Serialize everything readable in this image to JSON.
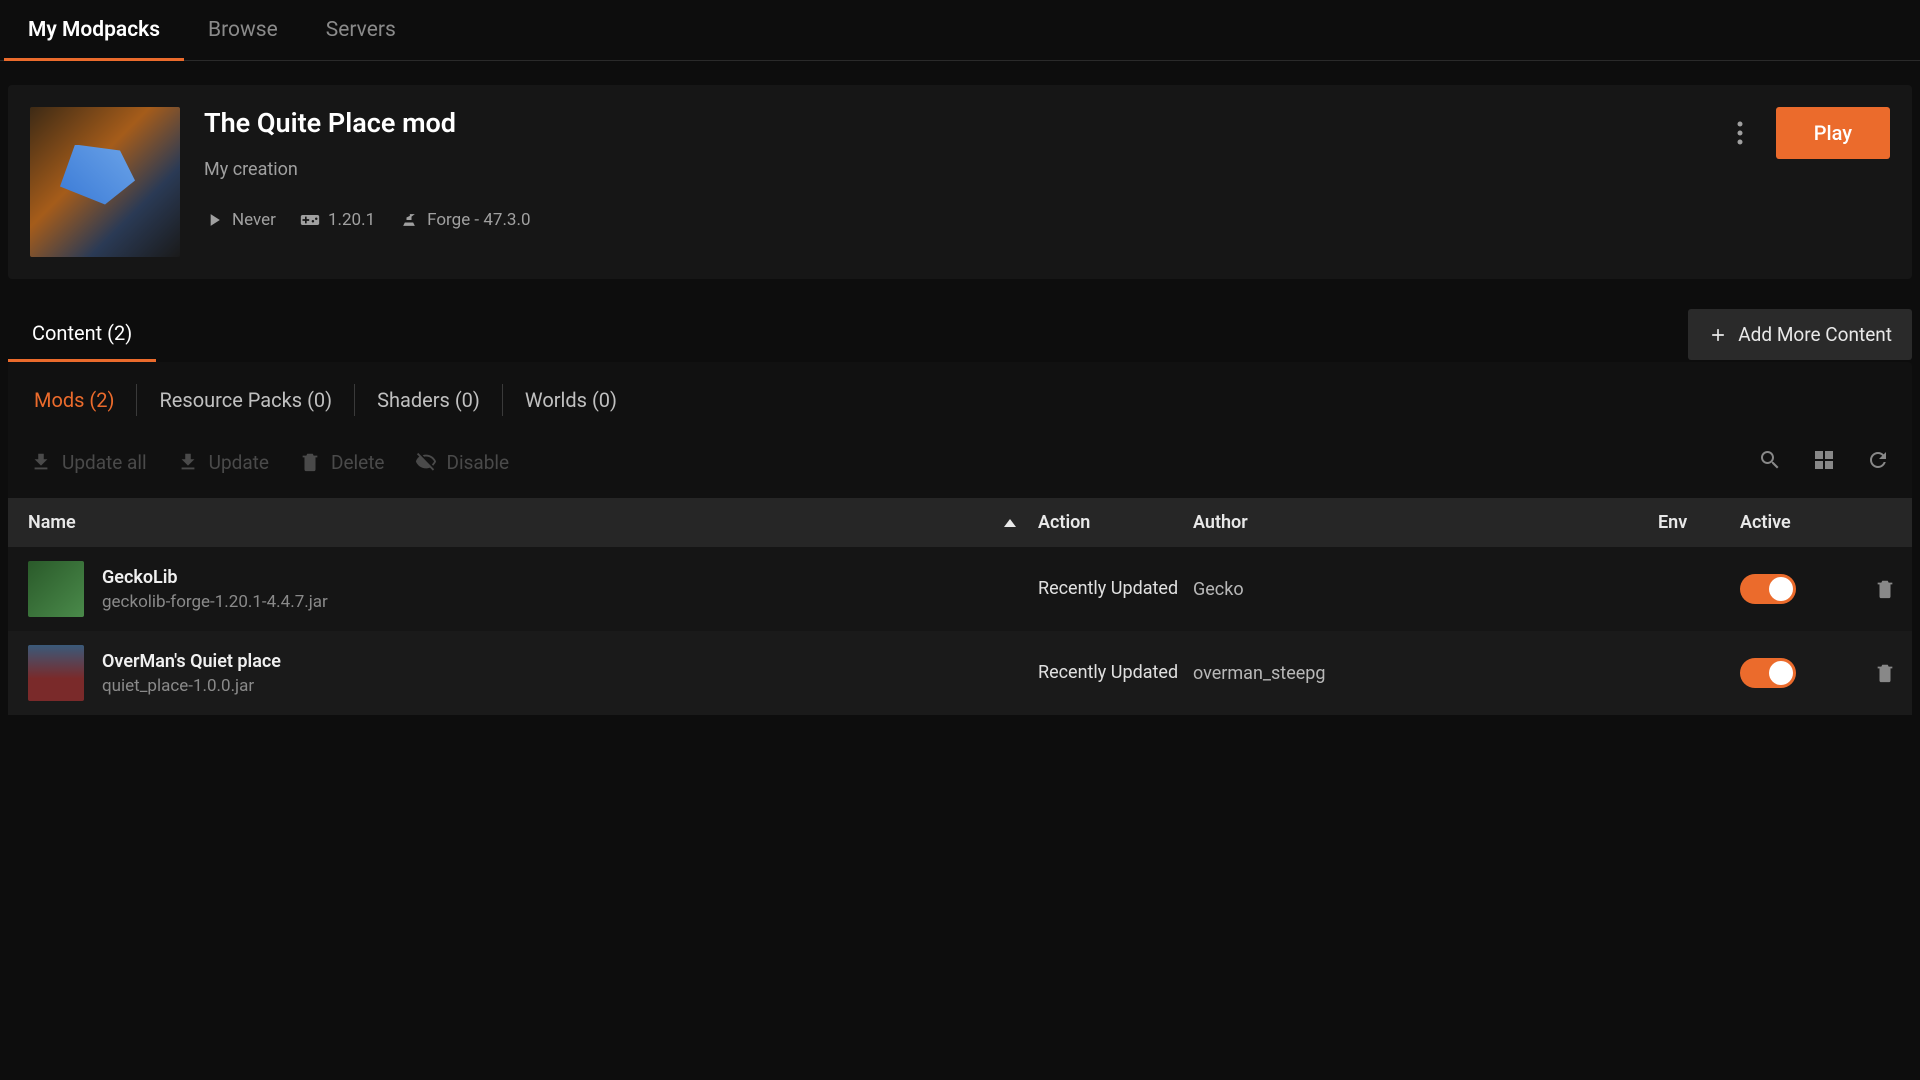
{
  "nav": {
    "items": [
      "My Modpacks",
      "Browse",
      "Servers"
    ],
    "active_index": 0
  },
  "modpack": {
    "title": "The Quite Place mod",
    "subtitle": "My creation",
    "last_played": "Never",
    "version": "1.20.1",
    "loader": "Forge - 47.3.0",
    "play_label": "Play"
  },
  "content": {
    "tab_label": "Content (2)",
    "add_label": "Add More Content",
    "subtabs": [
      "Mods (2)",
      "Resource Packs (0)",
      "Shaders (0)",
      "Worlds (0)"
    ],
    "active_subtab": 0,
    "bulk": {
      "update_all": "Update all",
      "update": "Update",
      "delete": "Delete",
      "disable": "Disable"
    },
    "columns": {
      "name": "Name",
      "action": "Action",
      "author": "Author",
      "env": "Env",
      "active": "Active"
    },
    "rows": [
      {
        "name": "GeckoLib",
        "file": "geckolib-forge-1.20.1-4.4.7.jar",
        "action": "Recently Updated",
        "author": "Gecko",
        "active": true
      },
      {
        "name": "OverMan's Quiet place",
        "file": "quiet_place-1.0.0.jar",
        "action": "Recently Updated",
        "author": "overman_steepg",
        "active": true
      }
    ]
  }
}
